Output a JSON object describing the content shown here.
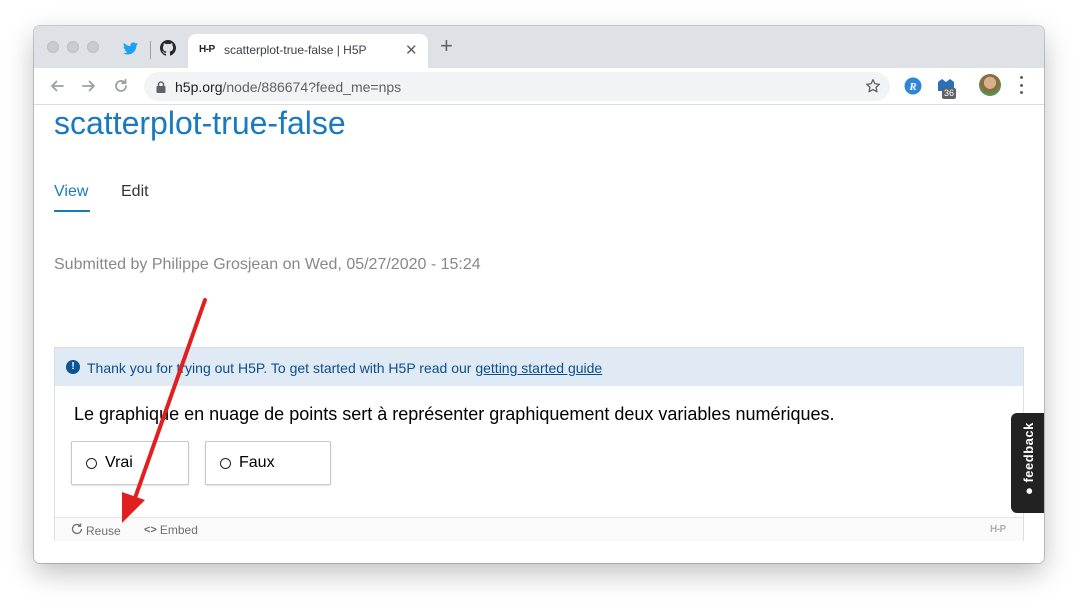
{
  "browser": {
    "tab": {
      "favicon_text": "H-P",
      "title": "scatterplot-true-false | H5P",
      "close_glyph": "✕"
    },
    "new_tab_glyph": "+",
    "url_host": "h5p.org",
    "url_path": "/node/886674?feed_me=nps",
    "extension_badge": "36",
    "icons": [
      "twitter-icon",
      "github-icon",
      "back-icon",
      "forward-icon",
      "reload-icon",
      "lock-icon",
      "bookmark-star-icon",
      "extension-icon",
      "profile-avatar",
      "menu-icon"
    ]
  },
  "page": {
    "title": "scatterplot-true-false",
    "tabs": [
      {
        "label": "View",
        "active": true
      },
      {
        "label": "Edit",
        "active": false
      }
    ],
    "submitted": "Submitted by Philippe Grosjean on Wed, 05/27/2020 - 15:24"
  },
  "h5p": {
    "notice_text": "Thank you for trying out H5P. To get started with H5P read our ",
    "notice_link": "getting started guide",
    "question": "Le graphique en nuage de points sert à représenter graphiquement deux variables numériques.",
    "answers": [
      {
        "label": "Vrai"
      },
      {
        "label": "Faux"
      }
    ],
    "footer": {
      "reuse": "Reuse",
      "embed": "Embed",
      "logo": "H-P"
    }
  },
  "feedback": {
    "label": "feedback"
  },
  "colors": {
    "accent": "#1a7ac0",
    "notice_bg": "#dfeaf4",
    "arrow": "#e02020"
  }
}
